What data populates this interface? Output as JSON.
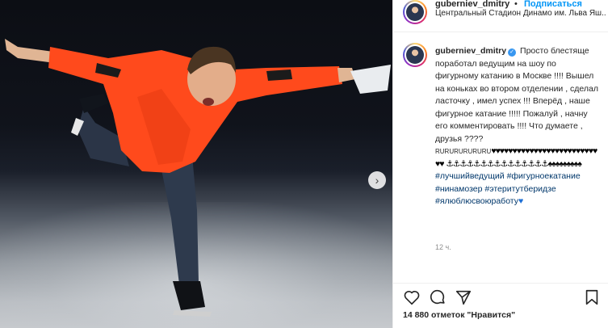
{
  "post": {
    "username": "guberniev_dmitry",
    "follow_label": "Подписаться",
    "separator": "•",
    "location": "Центральный Стадион Динамо им. Льва Яш...",
    "caption_text": "Просто блестяще поработал ведущим на шоу по фигурному катанию в Москве !!!! Вышел на коньках во втором отделении , сделал ласточку , имел успех !!! Вперёд , наше фигурное катание !!!!! Пожалуй , начну его комментировать !!!! Что думаете , друзья ???? ",
    "caption_flags": "RURURURURURU",
    "caption_hearts": "♥♥♥♥♥♥♥♥♥♥♥♥♥♥♥♥♥♥♥♥♥♥♥♥♥♥♥",
    "caption_anchors": "⚓⚓⚓⚓⚓⚓⚓⚓⚓⚓⚓⚓⚓⚓⚓♠♠♠♠♠♠♠♠♠",
    "hashtags": [
      "#лучшийведущий",
      "#фигурноекатание",
      "#нинамозер",
      "#этеритутберидзе",
      "#ялюблюсвоюработу"
    ],
    "final_heart": "♥",
    "time_ago": "12 ч.",
    "likes_text": "14 880 отметок \"Нравится\""
  },
  "icons": {
    "next": "chevron-right-icon",
    "like": "heart-icon",
    "comment": "comment-icon",
    "share": "share-icon",
    "save": "bookmark-icon",
    "verified": "verified-badge-icon"
  },
  "colors": {
    "link_blue": "#0095f6",
    "hashtag": "#00376b",
    "jacket": "#ff4a1c"
  }
}
